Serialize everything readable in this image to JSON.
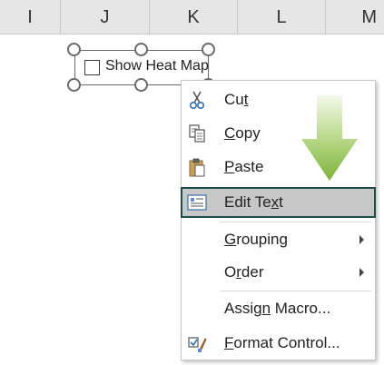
{
  "columns": [
    {
      "label": "I"
    },
    {
      "label": "J"
    },
    {
      "label": "K"
    },
    {
      "label": "L"
    },
    {
      "label": "M"
    }
  ],
  "form_control": {
    "label": "Show Heat Map",
    "checked": false
  },
  "context_menu": {
    "items": [
      {
        "label": "Cut",
        "accel": "t",
        "icon": "scissors-icon"
      },
      {
        "label": "Copy",
        "accel": "C",
        "icon": "copy-icon"
      },
      {
        "label": "Paste",
        "accel": "P",
        "icon": "paste-icon"
      },
      {
        "label": "Edit Text",
        "accel": "x",
        "icon": "edit-text-icon",
        "highlighted": true
      },
      {
        "label": "Grouping",
        "accel": "G",
        "submenu": true
      },
      {
        "label": "Order",
        "accel": "r",
        "submenu": true
      },
      {
        "label": "Assign Macro...",
        "accel": "n"
      },
      {
        "label": "Format Control...",
        "accel": "F",
        "icon": "format-control-icon"
      }
    ]
  },
  "colors": {
    "highlight_bg": "#c7c7c7",
    "highlight_border": "#1f4e4a",
    "arrow_green": "#8fbf45"
  }
}
